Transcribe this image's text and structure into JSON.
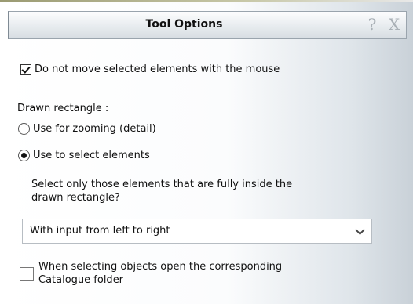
{
  "window": {
    "title": "Tool Options",
    "help_glyph": "?",
    "close_glyph": "X"
  },
  "options": {
    "no_move_label": "Do not move selected elements with the mouse",
    "no_move_checked": true,
    "drawn_rect_heading": "Drawn rectangle :",
    "zoom_label": "Use for zooming (detail)",
    "zoom_selected": false,
    "select_label": "Use to select elements",
    "select_selected": true,
    "fully_inside_line1": "Select only those elements that are fully inside the",
    "fully_inside_line2": "drawn rectangle?",
    "direction_value": "With input from left to right",
    "catalogue_line1": "When selecting objects open the corresponding",
    "catalogue_line2": "Catalogue folder",
    "catalogue_checked": false
  },
  "colors": {
    "title_bar_top": "#fdfdfe",
    "title_bar_bottom": "#d7dde2",
    "panel_edge": "#c9d1d8"
  },
  "icons": [
    "help-icon",
    "close-icon",
    "checkbox",
    "radio-button",
    "chevron-down-icon"
  ]
}
